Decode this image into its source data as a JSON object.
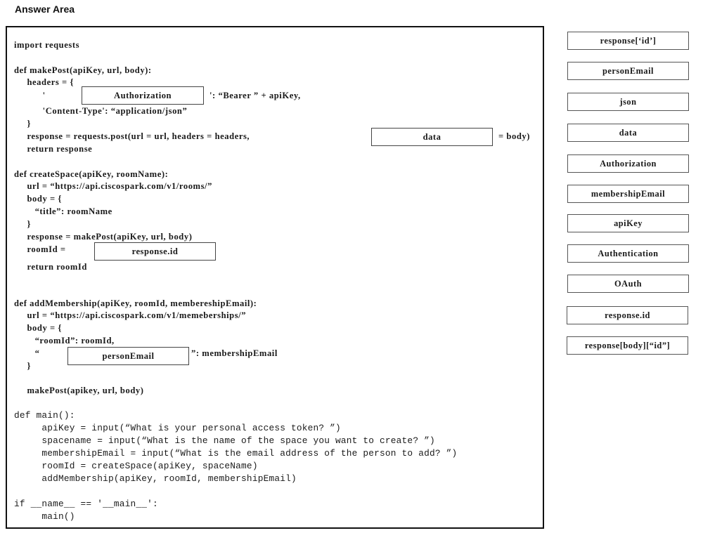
{
  "header": {
    "title": "Answer Area"
  },
  "code": {
    "lines": {
      "l1": "import requests",
      "l2": "def makePost(apiKey, url, body):",
      "l3": "     headers = {",
      "l4a": "           '",
      "l4b": "': “Bearer ” + apiKey,",
      "l5": "           'Content-Type': “application/json”",
      "l6": "     }",
      "l7a": "     response = requests.post(url = url, headers = headers,",
      "l7b": "= body)",
      "l8": "     return response",
      "l9": "def createSpace(apiKey, roomName):",
      "l10": "     url = “https://api.ciscospark.com/v1/rooms/”",
      "l11": "     body = {",
      "l12": "        “title”: roomName",
      "l13": "     }",
      "l14": "     response = makePost(apiKey, url, body)",
      "l15a": "     roomId =",
      "l16": "     return roomId",
      "l17": "def addMembership(apiKey, roomId, membereshipEmail):",
      "l18": "     url = “https://api.ciscospark.com/v1/memeberships/”",
      "l19": "     body = {",
      "l20": "        “roomId”: roomId,",
      "l21a": "        “",
      "l21b": "”: membershipEmail",
      "l22": "     }",
      "l23": "     makePost(apikey, url, body)",
      "l24": "def main():",
      "l25": "     apiKey = input(“What is your personal access token? ”)",
      "l26": "     spacename = input(“What is the name of the space you want to create? ”)",
      "l27": "     membershipEmail = input(“What is the email address of the person to add? ”)",
      "l28": "     roomId = createSpace(apiKey, spaceName)",
      "l29": "     addMembership(apiKey, roomId, membershipEmail)",
      "l30": "if __name__ == '__main__':",
      "l31": "     main()"
    },
    "slots": {
      "header_key": "Authorization",
      "post_param": "data",
      "room_id_expr": "response.id",
      "body_key": "personEmail"
    }
  },
  "options": [
    "response[‘id’]",
    "personEmail",
    "json",
    "data",
    "Authorization",
    "membershipEmail",
    "apiKey",
    "Authentication",
    "OAuth",
    "response.id",
    "response[body][“id”]"
  ]
}
